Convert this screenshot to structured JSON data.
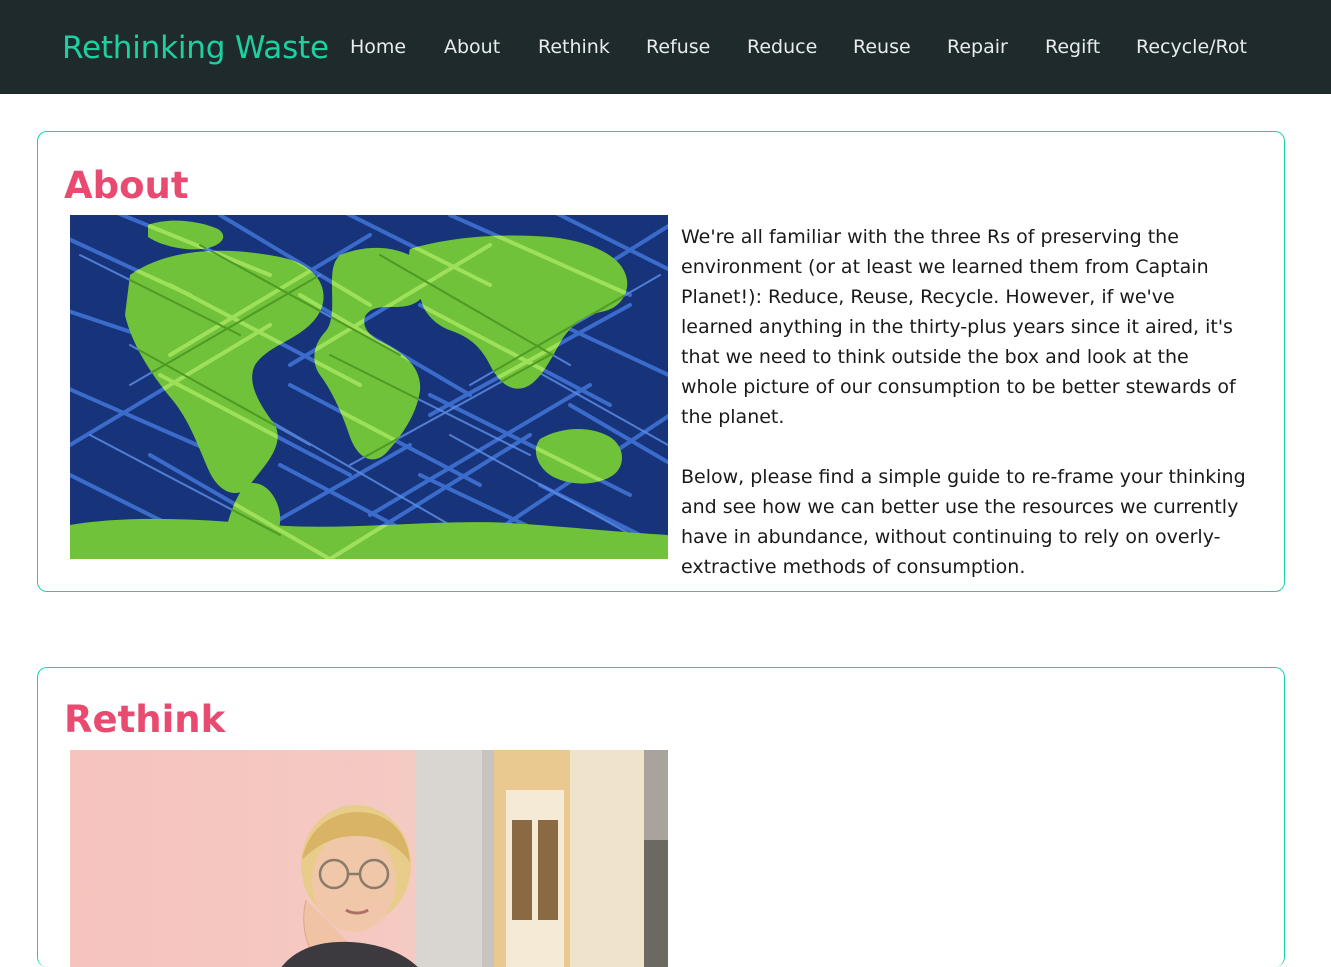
{
  "header": {
    "brand": "Rethinking Waste",
    "nav": [
      "Home",
      "About",
      "Rethink",
      "Refuse",
      "Reduce",
      "Reuse",
      "Repair",
      "Regift",
      "Recycle/Rot"
    ]
  },
  "about": {
    "title": "About",
    "image_description": "world-map-on-blue-grass-image",
    "paragraphs": [
      "We're all familiar with the three Rs of preserving the environment (or at least we learned them from Captain Planet!): Reduce, Reuse, Recycle. However, if we've learned anything in the thirty-plus years since it aired, it's that we need to think outside the box and look at the whole picture of our consumption to be better stewards of the planet.",
      "Below, please find a simple guide to re-frame your thinking and see how we can better use the resources we currently have in abundance, without continuing to rely on overly-extractive methods of consumption."
    ]
  },
  "rethink": {
    "title": "Rethink",
    "image_description": "woman-thinking-photo"
  },
  "colors": {
    "navbar_bg": "#1e2a2c",
    "brand": "#1ecf9f",
    "nav_text": "#e8ecec",
    "heading": "#e84a70",
    "card_border": "#1ecfae",
    "body_text": "#1a1a1a"
  }
}
